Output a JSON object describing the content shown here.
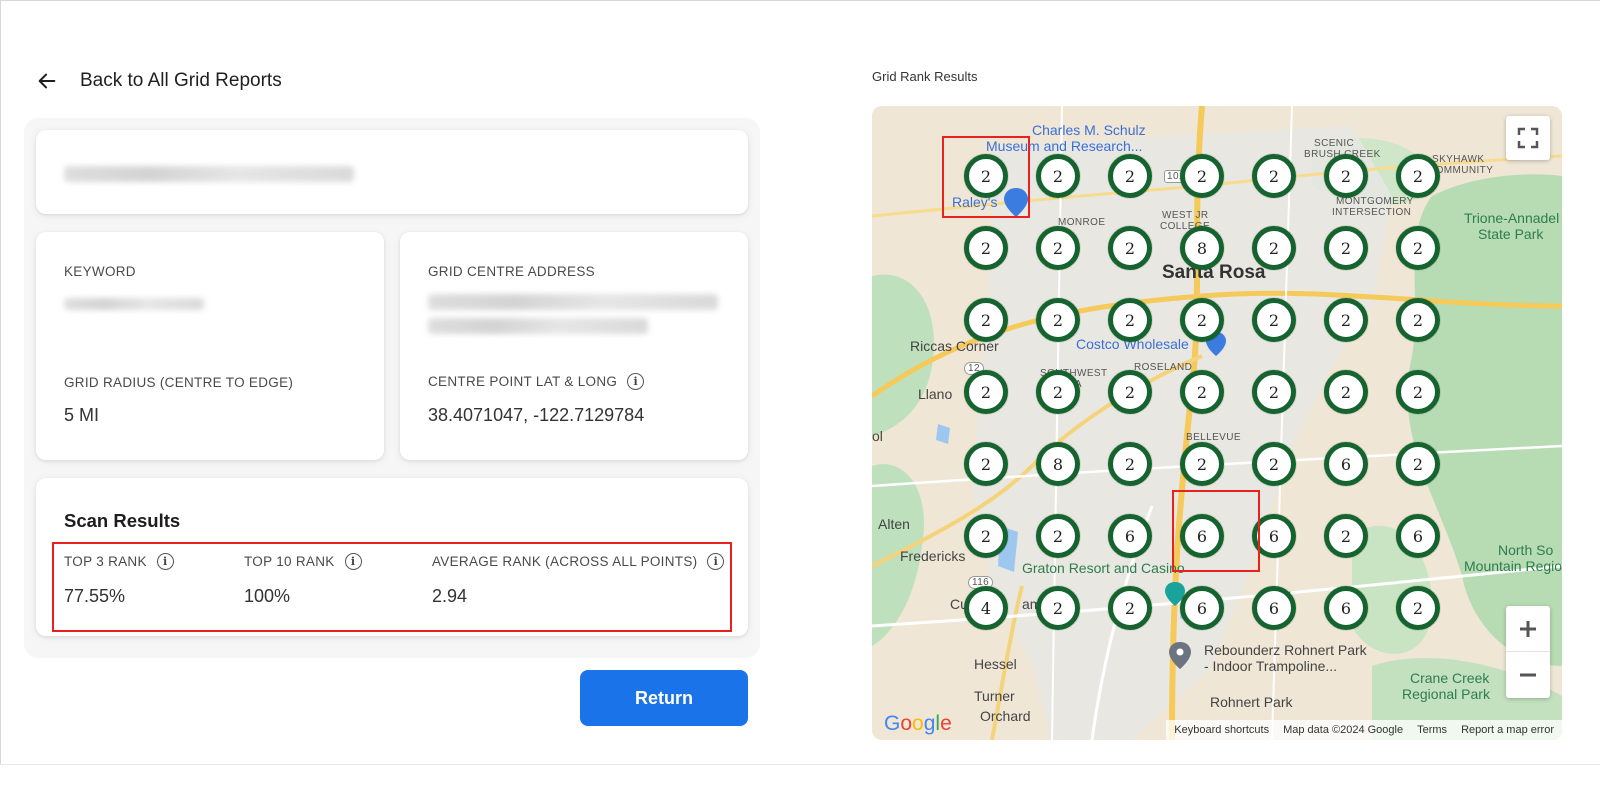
{
  "nav": {
    "back_label": "Back to All Grid Reports"
  },
  "details": {
    "keyword_label": "KEYWORD",
    "radius_label": "GRID RADIUS (CENTRE TO EDGE)",
    "radius_value": "5 MI",
    "address_label": "GRID CENTRE ADDRESS",
    "latlong_label": "CENTRE POINT LAT & LONG",
    "latlong_value": "38.4071047, -122.7129784"
  },
  "scan": {
    "title": "Scan Results",
    "top3_label": "TOP 3 RANK",
    "top3_value": "77.55%",
    "top10_label": "TOP 10 RANK",
    "top10_value": "100%",
    "avg_label": "AVERAGE RANK (ACROSS ALL POINTS)",
    "avg_value": "2.94"
  },
  "return_label": "Return",
  "map": {
    "title": "Grid Rank Results",
    "grid": [
      [
        "2",
        "2",
        "2",
        "2",
        "2",
        "2",
        "2"
      ],
      [
        "2",
        "2",
        "2",
        "8",
        "2",
        "2",
        "2"
      ],
      [
        "2",
        "2",
        "2",
        "2",
        "2",
        "2",
        "2"
      ],
      [
        "2",
        "2",
        "2",
        "2",
        "2",
        "2",
        "2"
      ],
      [
        "2",
        "8",
        "2",
        "2",
        "2",
        "6",
        "2"
      ],
      [
        "2",
        "2",
        "6",
        "6",
        "6",
        "2",
        "6"
      ],
      [
        "4",
        "2",
        "2",
        "6",
        "6",
        "6",
        "2"
      ]
    ],
    "labels": {
      "charles": "Charles M. Schulz",
      "museum": "Museum and Research...",
      "scenic": "SCENIC",
      "brush": "BRUSH CREEK",
      "skyhawk": "SKYHAWK",
      "community": "COMMUNITY",
      "raleys": "Raley's",
      "monroe": "MONROE",
      "westjr": "WEST JR",
      "college": "COLLEGE",
      "montgomery": "MONTGOMERY",
      "intersection": "INTERSECTION",
      "trione": "Trione-Annadel",
      "statepark": "State Park",
      "santarosa": "Santa Rosa",
      "riccas": "Riccas Corner",
      "costco": "Costco Wholesale",
      "roseland": "ROSELAND",
      "southwest": "SOUTHWEST",
      "rosa": "ROSA",
      "llano": "Llano",
      "bellevue": "BELLEVUE",
      "alten": "Alten",
      "fredericks": "Fredericks",
      "graton": "Graton Resort and Casino",
      "northso": "North So",
      "mountain": "Mountain Regiona",
      "cu": "Cu",
      "am": "am",
      "amily": "amily",
      "rebounderz": "Rebounderz Rohnert Park",
      "trampoline": "- Indoor Trampoline...",
      "hessel": "Hessel",
      "cranecreek": "Crane Creek",
      "regionalpark": "Regional Park",
      "turner": "Turner",
      "orchard": "Orchard",
      "rohnert": "Rohnert Park",
      "r101": "101",
      "r12": "12",
      "r116": "116",
      "ol": "ol"
    },
    "attribution": {
      "keyboard": "Keyboard shortcuts",
      "mapdata": "Map data ©2024 Google",
      "terms": "Terms",
      "report": "Report a map error"
    },
    "google": "Google"
  },
  "colors": {
    "accent": "#1a73e8",
    "highlight": "#e8231f",
    "marker_ring": "#15632e"
  }
}
